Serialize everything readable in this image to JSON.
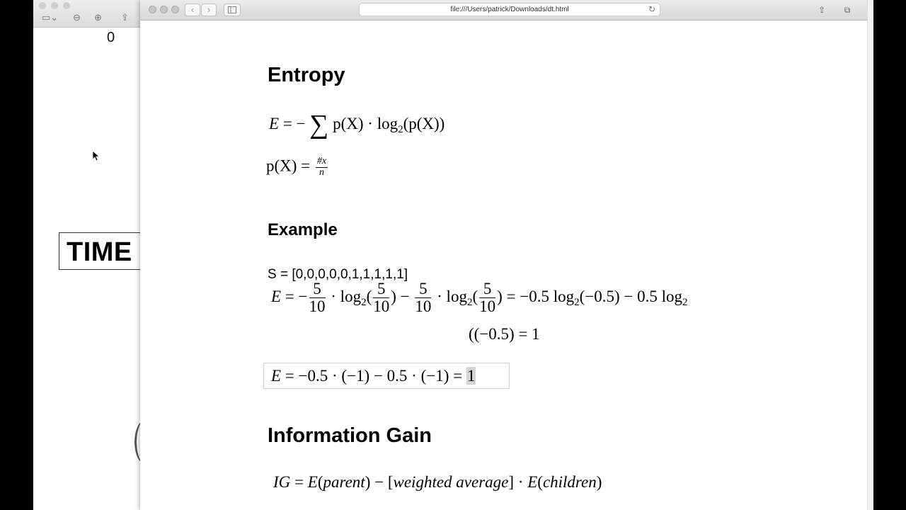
{
  "left_window": {
    "counter": "0",
    "time_label": "TIME"
  },
  "browser": {
    "url": "file:///Users/patrick/Downloads/dt.html",
    "nav_back": "‹",
    "nav_forward": "›"
  },
  "page": {
    "entropy_heading": "Entropy",
    "entropy_formula": {
      "lhs": "E",
      "eq": " = −",
      "body_a": "p(X) · log",
      "sub": "2",
      "body_b": "(p(X))"
    },
    "probability_formula": {
      "lhs": "p(X) = ",
      "num": "#x",
      "den": "n"
    },
    "example_heading": "Example",
    "sample_set": "S = [0,0,0,0,0,1,1,1,1,1]",
    "example_formula": {
      "lhs": "E",
      "eq": " = −",
      "f1_num": "5",
      "f1_den": "10",
      "t1": " · log",
      "s1": "2",
      "open1": "(",
      "f2_num": "5",
      "f2_den": "10",
      "close1": ") − ",
      "f3_num": "5",
      "f3_den": "10",
      "t2": " · log",
      "s2": "2",
      "open2": "(",
      "f4_num": "5",
      "f4_den": "10",
      "close2": ") = −0.5 log",
      "s3": "2",
      "mid": "(−0.5) − 0.5 log",
      "s4": "2",
      "continuation": "((−0.5) = 1"
    },
    "result_formula": {
      "lhs": "E",
      "body": " = −0.5 · (−1) − 0.5 · (−1) = ",
      "value": "1"
    },
    "ig_heading": "Information Gain",
    "ig_formula": {
      "ig": "IG",
      "eq": " = ",
      "e1": "E",
      "p1": "(",
      "parent": "parent",
      "mid": ") − [",
      "wa": "weighted average",
      "dot": "] · ",
      "e2": "E",
      "p2": "(",
      "children": "children",
      "close": ")"
    }
  }
}
